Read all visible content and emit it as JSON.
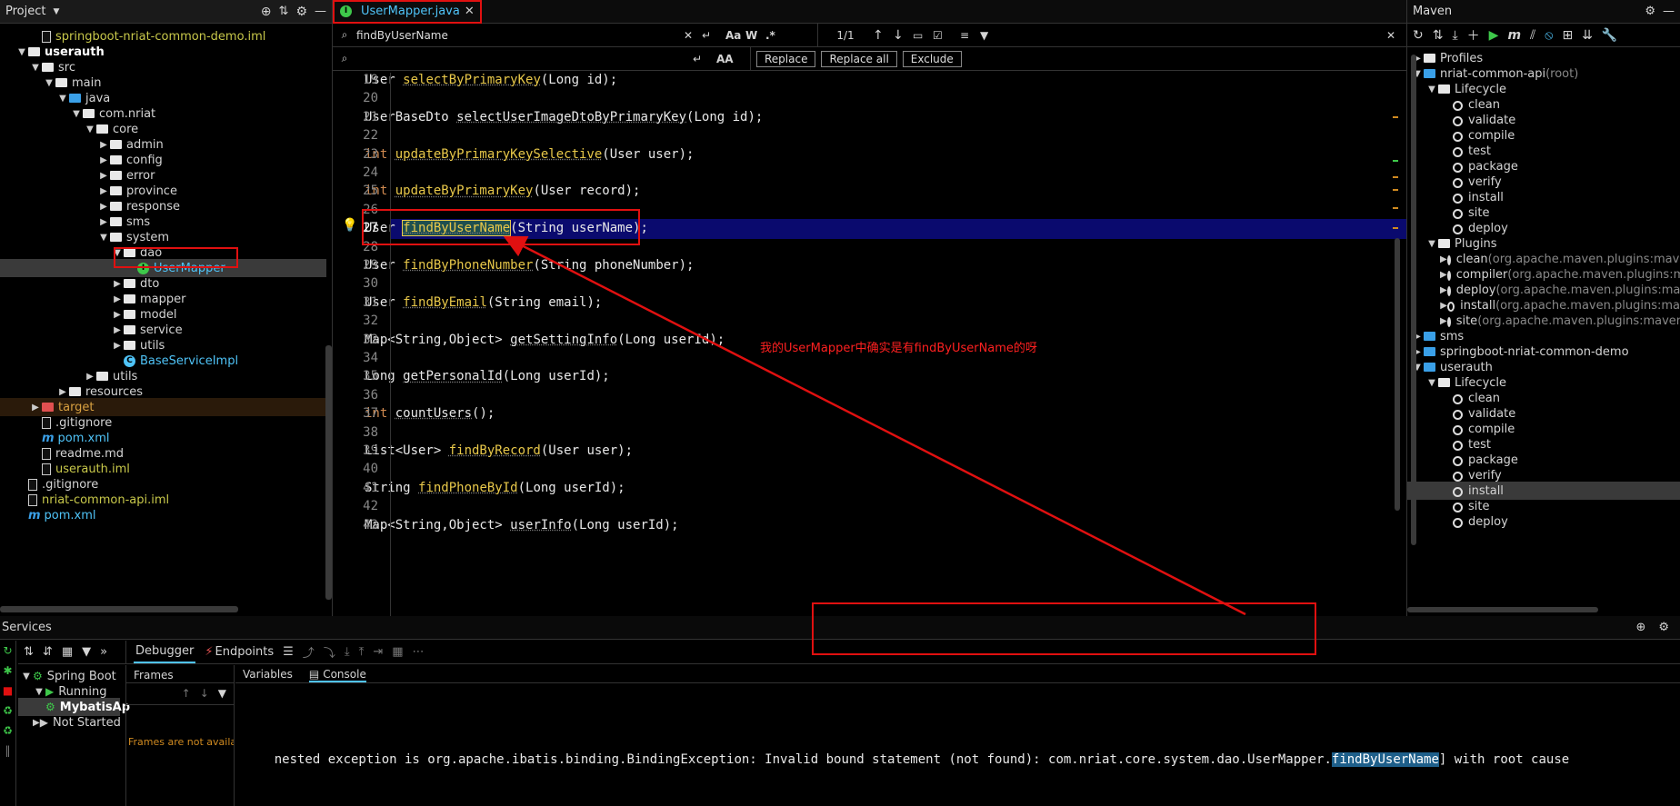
{
  "project": {
    "title": "Project",
    "items": [
      {
        "label": "springboot-nriat-common-demo.iml",
        "indent": 2,
        "kind": "iml"
      },
      {
        "label": "userauth",
        "indent": 1,
        "kind": "module",
        "open": true
      },
      {
        "label": "src",
        "indent": 2,
        "kind": "folder",
        "open": true
      },
      {
        "label": "main",
        "indent": 3,
        "kind": "folder",
        "open": true
      },
      {
        "label": "java",
        "indent": 4,
        "kind": "folder-blue",
        "open": true
      },
      {
        "label": "com.nriat",
        "indent": 5,
        "kind": "folder",
        "open": true
      },
      {
        "label": "core",
        "indent": 6,
        "kind": "folder",
        "open": true
      },
      {
        "label": "admin",
        "indent": 7,
        "kind": "folder",
        "open": false
      },
      {
        "label": "config",
        "indent": 7,
        "kind": "folder",
        "open": false
      },
      {
        "label": "error",
        "indent": 7,
        "kind": "folder",
        "open": false
      },
      {
        "label": "province",
        "indent": 7,
        "kind": "folder",
        "open": false
      },
      {
        "label": "response",
        "indent": 7,
        "kind": "folder",
        "open": false
      },
      {
        "label": "sms",
        "indent": 7,
        "kind": "folder",
        "open": false
      },
      {
        "label": "system",
        "indent": 7,
        "kind": "folder",
        "open": true
      },
      {
        "label": "dao",
        "indent": 8,
        "kind": "folder",
        "open": true
      },
      {
        "label": "UserMapper",
        "indent": 9,
        "kind": "interface",
        "selected": true
      },
      {
        "label": "dto",
        "indent": 8,
        "kind": "folder",
        "open": false
      },
      {
        "label": "mapper",
        "indent": 8,
        "kind": "folder",
        "open": false
      },
      {
        "label": "model",
        "indent": 8,
        "kind": "folder",
        "open": false
      },
      {
        "label": "service",
        "indent": 8,
        "kind": "folder",
        "open": false
      },
      {
        "label": "utils",
        "indent": 8,
        "kind": "folder",
        "open": false
      },
      {
        "label": "BaseServiceImpl",
        "indent": 8,
        "kind": "class"
      },
      {
        "label": "utils",
        "indent": 6,
        "kind": "folder",
        "open": false
      },
      {
        "label": "resources",
        "indent": 4,
        "kind": "folder",
        "open": false
      },
      {
        "label": "target",
        "indent": 2,
        "kind": "folder-red",
        "open": false,
        "highlight": true
      },
      {
        "label": ".gitignore",
        "indent": 2,
        "kind": "file"
      },
      {
        "label": "pom.xml",
        "indent": 2,
        "kind": "maven"
      },
      {
        "label": "readme.md",
        "indent": 2,
        "kind": "md"
      },
      {
        "label": "userauth.iml",
        "indent": 2,
        "kind": "iml"
      },
      {
        "label": ".gitignore",
        "indent": 1,
        "kind": "file"
      },
      {
        "label": "nriat-common-api.iml",
        "indent": 1,
        "kind": "iml"
      },
      {
        "label": "pom.xml",
        "indent": 1,
        "kind": "maven"
      }
    ]
  },
  "editor": {
    "tab": "UserMapper.java",
    "search": {
      "query": "findByUserName",
      "count": "1/1",
      "replace_value": "",
      "opt_case": "Aa",
      "opt_word": "W",
      "opt_regex": ".*",
      "opt_case2": "AA"
    },
    "replace_buttons": [
      "Replace",
      "Replace all",
      "Exclude"
    ],
    "lines": [
      {
        "n": "19",
        "pre": "User ",
        "kwpre": "",
        "method": "selectByPrimaryKey",
        "post": "(Long id);",
        "mstyle": "y"
      },
      {
        "n": "20",
        "pre": "",
        "kwpre": "",
        "method": "",
        "post": "",
        "mstyle": ""
      },
      {
        "n": "21",
        "pre": "UserBaseDto ",
        "kwpre": "",
        "method": "selectUserImageDtoByPrimaryKey",
        "post": "(Long id);",
        "mstyle": "w"
      },
      {
        "n": "22",
        "pre": "",
        "kwpre": "",
        "method": "",
        "post": "",
        "mstyle": ""
      },
      {
        "n": "23",
        "pre": "",
        "kwpre": "int ",
        "method": "updateByPrimaryKeySelective",
        "post": "(User user);",
        "mstyle": "y"
      },
      {
        "n": "24",
        "pre": "",
        "kwpre": "",
        "method": "",
        "post": "",
        "mstyle": ""
      },
      {
        "n": "25",
        "pre": "",
        "kwpre": "int ",
        "method": "updateByPrimaryKey",
        "post": "(User record);",
        "mstyle": "y"
      },
      {
        "n": "26",
        "pre": "",
        "kwpre": "",
        "method": "",
        "post": "",
        "mstyle": ""
      },
      {
        "n": "27",
        "pre": "User ",
        "kwpre": "",
        "method": "findByUserName",
        "post": "(String userName);",
        "mstyle": "match"
      },
      {
        "n": "28",
        "pre": "",
        "kwpre": "",
        "method": "",
        "post": "",
        "mstyle": ""
      },
      {
        "n": "29",
        "pre": "User ",
        "kwpre": "",
        "method": "findByPhoneNumber",
        "post": "(String phoneNumber);",
        "mstyle": "y"
      },
      {
        "n": "30",
        "pre": "",
        "kwpre": "",
        "method": "",
        "post": "",
        "mstyle": ""
      },
      {
        "n": "31",
        "pre": "User ",
        "kwpre": "",
        "method": "findByEmail",
        "post": "(String email);",
        "mstyle": "y"
      },
      {
        "n": "32",
        "pre": "",
        "kwpre": "",
        "method": "",
        "post": "",
        "mstyle": ""
      },
      {
        "n": "33",
        "pre": "Map<String,Object> ",
        "kwpre": "",
        "method": "getSettingInfo",
        "post": "(Long userId);",
        "mstyle": "w"
      },
      {
        "n": "34",
        "pre": "",
        "kwpre": "",
        "method": "",
        "post": "",
        "mstyle": ""
      },
      {
        "n": "35",
        "pre": "Long ",
        "kwpre": "",
        "method": "getPersonalId",
        "post": "(Long userId);",
        "mstyle": "w"
      },
      {
        "n": "36",
        "pre": "",
        "kwpre": "",
        "method": "",
        "post": "",
        "mstyle": ""
      },
      {
        "n": "37",
        "pre": "",
        "kwpre": "int ",
        "method": "countUsers",
        "post": "();",
        "mstyle": "w"
      },
      {
        "n": "38",
        "pre": "",
        "kwpre": "",
        "method": "",
        "post": "",
        "mstyle": ""
      },
      {
        "n": "39",
        "pre": "List<User> ",
        "kwpre": "",
        "method": "findByRecord",
        "post": "(User user);",
        "mstyle": "y"
      },
      {
        "n": "40",
        "pre": "",
        "kwpre": "",
        "method": "",
        "post": "",
        "mstyle": ""
      },
      {
        "n": "41",
        "pre": "String ",
        "kwpre": "",
        "method": "findPhoneById",
        "post": "(Long userId);",
        "mstyle": "y"
      },
      {
        "n": "42",
        "pre": "",
        "kwpre": "",
        "method": "",
        "post": "",
        "mstyle": ""
      },
      {
        "n": "43",
        "pre": "Map<String,Object> ",
        "kwpre": "",
        "method": "userInfo",
        "post": "(Long userId);",
        "mstyle": "w"
      }
    ],
    "annotation": "我的UserMapper中确实是有findByUserName的呀"
  },
  "maven": {
    "title": "Maven",
    "items": [
      {
        "label": "Profiles",
        "sub": "",
        "indent": 0,
        "kind": "folder",
        "open": false
      },
      {
        "label": "nriat-common-api",
        "sub": " (root)",
        "indent": 0,
        "kind": "module",
        "open": true
      },
      {
        "label": "Lifecycle",
        "sub": "",
        "indent": 1,
        "kind": "folder",
        "open": true
      },
      {
        "label": "clean",
        "sub": "",
        "indent": 2,
        "kind": "goal"
      },
      {
        "label": "validate",
        "sub": "",
        "indent": 2,
        "kind": "goal"
      },
      {
        "label": "compile",
        "sub": "",
        "indent": 2,
        "kind": "goal"
      },
      {
        "label": "test",
        "sub": "",
        "indent": 2,
        "kind": "goal"
      },
      {
        "label": "package",
        "sub": "",
        "indent": 2,
        "kind": "goal"
      },
      {
        "label": "verify",
        "sub": "",
        "indent": 2,
        "kind": "goal"
      },
      {
        "label": "install",
        "sub": "",
        "indent": 2,
        "kind": "goal"
      },
      {
        "label": "site",
        "sub": "",
        "indent": 2,
        "kind": "goal"
      },
      {
        "label": "deploy",
        "sub": "",
        "indent": 2,
        "kind": "goal"
      },
      {
        "label": "Plugins",
        "sub": "",
        "indent": 1,
        "kind": "folder",
        "open": true
      },
      {
        "label": "clean",
        "sub": " (org.apache.maven.plugins:maven",
        "indent": 2,
        "kind": "plugin",
        "open": false
      },
      {
        "label": "compiler",
        "sub": " (org.apache.maven.plugins:m",
        "indent": 2,
        "kind": "plugin",
        "open": false
      },
      {
        "label": "deploy",
        "sub": " (org.apache.maven.plugins:ma",
        "indent": 2,
        "kind": "plugin",
        "open": false
      },
      {
        "label": "install",
        "sub": " (org.apache.maven.plugins:ma",
        "indent": 2,
        "kind": "plugin",
        "open": false
      },
      {
        "label": "site",
        "sub": " (org.apache.maven.plugins:maven-",
        "indent": 2,
        "kind": "plugin",
        "open": false
      },
      {
        "label": "sms",
        "sub": "",
        "indent": 0,
        "kind": "module",
        "open": false
      },
      {
        "label": "springboot-nriat-common-demo",
        "sub": "",
        "indent": 0,
        "kind": "module",
        "open": false
      },
      {
        "label": "userauth",
        "sub": "",
        "indent": 0,
        "kind": "module",
        "open": true
      },
      {
        "label": "Lifecycle",
        "sub": "",
        "indent": 1,
        "kind": "folder",
        "open": true
      },
      {
        "label": "clean",
        "sub": "",
        "indent": 2,
        "kind": "goal"
      },
      {
        "label": "validate",
        "sub": "",
        "indent": 2,
        "kind": "goal"
      },
      {
        "label": "compile",
        "sub": "",
        "indent": 2,
        "kind": "goal"
      },
      {
        "label": "test",
        "sub": "",
        "indent": 2,
        "kind": "goal"
      },
      {
        "label": "package",
        "sub": "",
        "indent": 2,
        "kind": "goal"
      },
      {
        "label": "verify",
        "sub": "",
        "indent": 2,
        "kind": "goal"
      },
      {
        "label": "install",
        "sub": "",
        "indent": 2,
        "kind": "goal",
        "selected": true
      },
      {
        "label": "site",
        "sub": "",
        "indent": 2,
        "kind": "goal"
      },
      {
        "label": "deploy",
        "sub": "",
        "indent": 2,
        "kind": "goal"
      }
    ]
  },
  "services": {
    "title": "Services",
    "tabs": {
      "debugger": "Debugger",
      "endpoints": "Endpoints"
    },
    "tree": [
      {
        "label": "Spring Boot",
        "indent": 0
      },
      {
        "label": "Running",
        "indent": 1
      },
      {
        "label": "MybatisAp",
        "indent": 2
      },
      {
        "label": "Not Started",
        "indent": 1
      }
    ],
    "frames_title": "Frames",
    "frames_empty": "Frames are not availabl",
    "var_tab": "Variables",
    "console_tab": "Console",
    "console_pre": "nested exception is org.apache.ibatis.binding.BindingException: Invalid bound statement (not found): com.nriat.core.system.dao.UserMapper.",
    "console_match": "findByUserName",
    "console_post": "] with root cause"
  }
}
